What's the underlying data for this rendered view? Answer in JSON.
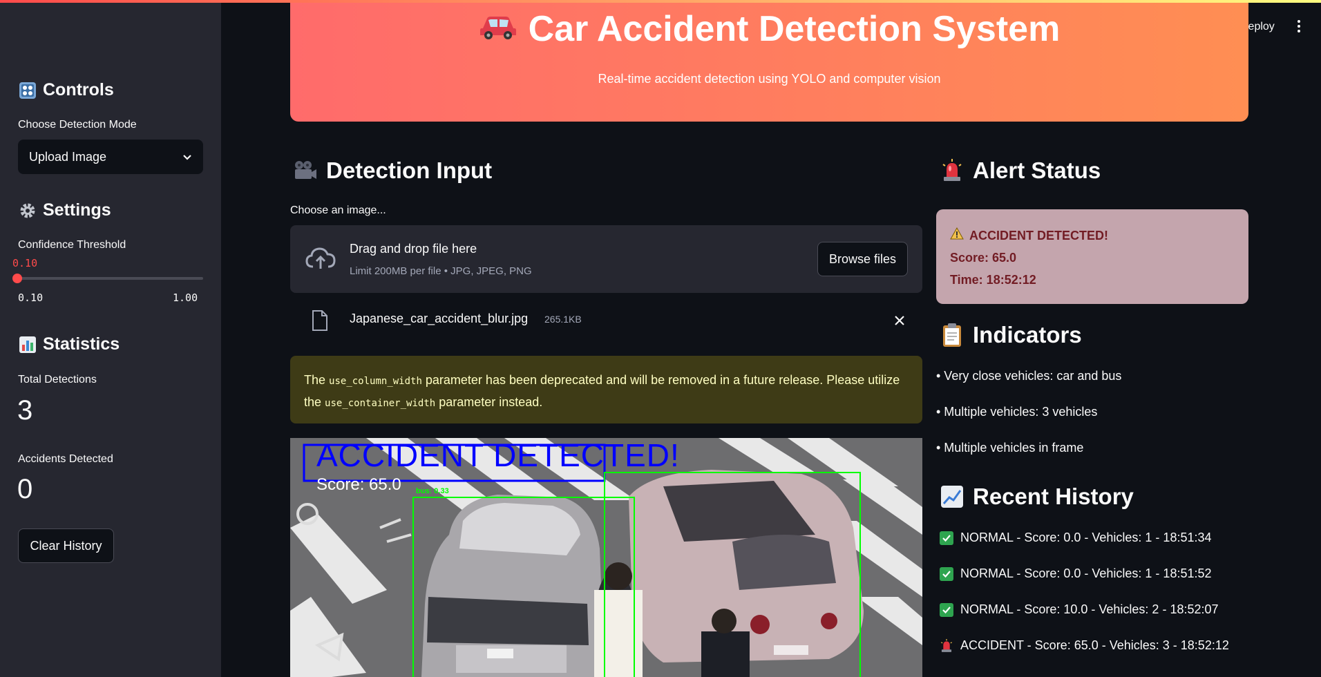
{
  "header": {
    "deploy_label": "Deploy"
  },
  "banner": {
    "title": "Car Accident Detection System",
    "subtitle": "Real-time accident detection using YOLO and computer vision",
    "icon": "car-icon"
  },
  "sidebar": {
    "controls_title": "Controls",
    "controls_icon": "control-knobs-icon",
    "mode_label": "Choose Detection Mode",
    "mode_value": "Upload Image",
    "settings_title": "Settings",
    "settings_icon": "gear-icon",
    "confidence_label": "Confidence Threshold",
    "confidence_value": "0.10",
    "confidence_min": "0.10",
    "confidence_max": "1.00",
    "confidence_fraction": 0.0,
    "statistics_title": "Statistics",
    "statistics_icon": "bar-chart-icon",
    "total_detections_label": "Total Detections",
    "total_detections_value": "3",
    "accidents_label": "Accidents Detected",
    "accidents_value": "0",
    "clear_history_label": "Clear History"
  },
  "detection_input": {
    "title": "Detection Input",
    "icon": "movie-camera-icon",
    "upload_label": "Choose an image...",
    "drop_title": "Drag and drop file here",
    "drop_limit": "Limit 200MB per file • JPG, JPEG, PNG",
    "browse_label": "Browse files",
    "file_name": "Japanese_car_accident_blur.jpg",
    "file_size": "265.1KB",
    "warning_pre": "The ",
    "warning_code1": "use_column_width",
    "warning_mid": " parameter has been deprecated and will be removed in a future release. Please utilize the ",
    "warning_code2": "use_container_width",
    "warning_post": " parameter instead.",
    "overlay_title": "ACCIDENT DETECTED!",
    "overlay_score": "Score: 65.0"
  },
  "alert": {
    "title": "Alert Status",
    "icon": "rotating-light-icon",
    "line1": "ACCIDENT DETECTED!",
    "line2": "Score: 65.0",
    "line3": "Time: 18:52:12"
  },
  "indicators": {
    "title": "Indicators",
    "icon": "clipboard-icon",
    "items": [
      "• Very close vehicles: car and bus",
      "• Multiple vehicles: 3 vehicles",
      "• Multiple vehicles in frame"
    ]
  },
  "history": {
    "title": "Recent History",
    "icon": "chart-increasing-icon",
    "items": [
      "NORMAL - Score: 0.0 - Vehicles: 1 - 18:51:34",
      "NORMAL - Score: 0.0 - Vehicles: 1 - 18:51:52",
      "NORMAL - Score: 10.0 - Vehicles: 2 - 18:52:07",
      "ACCIDENT - Score: 65.0 - Vehicles: 3 - 18:52:12"
    ]
  },
  "colors": {
    "accent": "#ff4b4b",
    "banner_start": "#ff6b6b",
    "banner_end": "#ff8e53",
    "alert_bg": "#c4a5ad",
    "warning_bg": "#3e3b16",
    "box_green": "#00ff00",
    "box_blue": "#0000ff"
  }
}
